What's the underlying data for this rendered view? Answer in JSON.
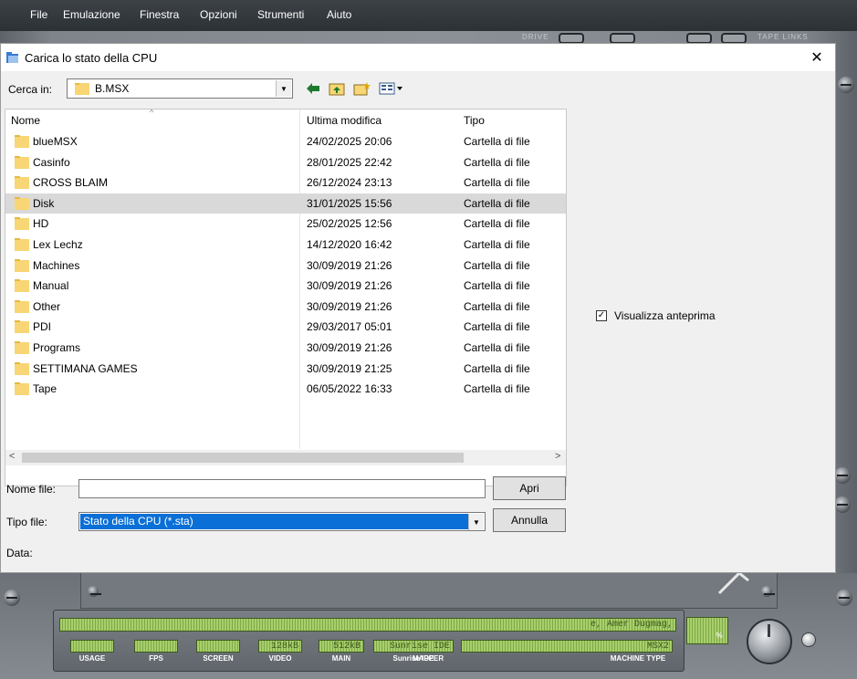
{
  "menubar": {
    "items": [
      "File",
      "Emulazione",
      "Finestra",
      "Opzioni",
      "Strumenti",
      "Aiuto"
    ]
  },
  "background": {
    "knob_labels": [
      "DRIVE",
      "TAPE LINKS"
    ],
    "status": {
      "main_display_text": "e, Amer Dugmag,",
      "usage_label": "USAGE",
      "fps_label": "FPS",
      "screen_label": "SCREEN",
      "video_value": "128kB",
      "video_label": "VIDEO",
      "main_value": "512kB",
      "main_label": "MAIN",
      "mapper_value": "Sunrise IDE",
      "mapper_label": "MAPPER",
      "machine_value": "MSX2",
      "machine_label": "MACHINE TYPE",
      "volume_symbol": "%"
    }
  },
  "dialog": {
    "title": "Carica lo stato della CPU",
    "close_symbol": "✕",
    "lookin_label": "Cerca in:",
    "lookin_value": "B.MSX",
    "toolbar_icons": [
      "back-icon",
      "up-folder-icon",
      "new-folder-icon",
      "view-menu-icon"
    ],
    "columns": {
      "name": "Nome",
      "modified": "Ultima modifica",
      "type": "Tipo"
    },
    "files": [
      {
        "name": "blueMSX",
        "modified": "24/02/2025 20:06",
        "type": "Cartella di file"
      },
      {
        "name": "Casinfo",
        "modified": "28/01/2025 22:42",
        "type": "Cartella di file"
      },
      {
        "name": "CROSS BLAIM",
        "modified": "26/12/2024 23:13",
        "type": "Cartella di file"
      },
      {
        "name": "Disk",
        "modified": "31/01/2025 15:56",
        "type": "Cartella di file",
        "selected": true
      },
      {
        "name": "HD",
        "modified": "25/02/2025 12:56",
        "type": "Cartella di file"
      },
      {
        "name": "Lex Lechz",
        "modified": "14/12/2020 16:42",
        "type": "Cartella di file"
      },
      {
        "name": "Machines",
        "modified": "30/09/2019 21:26",
        "type": "Cartella di file"
      },
      {
        "name": "Manual",
        "modified": "30/09/2019 21:26",
        "type": "Cartella di file"
      },
      {
        "name": "Other",
        "modified": "30/09/2019 21:26",
        "type": "Cartella di file"
      },
      {
        "name": "PDI",
        "modified": "29/03/2017 05:01",
        "type": "Cartella di file"
      },
      {
        "name": "Programs",
        "modified": "30/09/2019 21:26",
        "type": "Cartella di file"
      },
      {
        "name": "SETTIMANA GAMES",
        "modified": "30/09/2019 21:25",
        "type": "Cartella di file"
      },
      {
        "name": "Tape",
        "modified": "06/05/2022 16:33",
        "type": "Cartella di file"
      }
    ],
    "scroll_left": "<",
    "scroll_right": ">",
    "preview_label": "Visualizza anteprima",
    "preview_checked": true,
    "filename_label": "Nome file:",
    "filename_value": "",
    "open_button": "Apri",
    "filetype_label": "Tipo file:",
    "filetype_value": "Stato della CPU   (*.sta)",
    "cancel_button": "Annulla",
    "date_label": "Data:"
  },
  "colors": {
    "selection": "#0a6fd6",
    "row_highlight": "#d9d9d9",
    "lcd_green": "#a8cf6a",
    "folder_yellow": "#f8d675"
  }
}
